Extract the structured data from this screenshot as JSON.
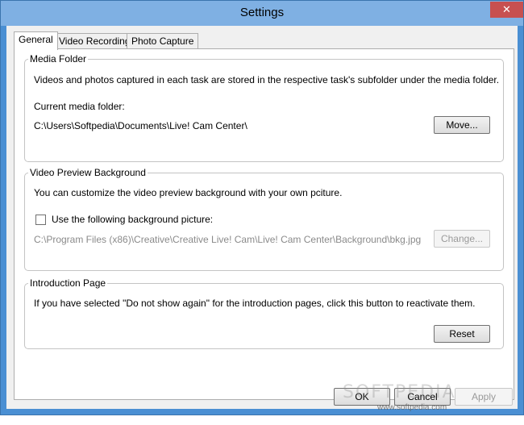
{
  "window": {
    "title": "Settings",
    "close_glyph": "✕"
  },
  "tabs": [
    {
      "label": "General",
      "active": true
    },
    {
      "label": "Video Recording",
      "active": false
    },
    {
      "label": "Photo Capture",
      "active": false
    }
  ],
  "media_folder": {
    "group_label": "Media Folder",
    "description": "Videos and photos captured in each task are stored in the respective task's subfolder under the media folder.",
    "current_label": "Current media folder:",
    "current_path": "C:\\Users\\Softpedia\\Documents\\Live! Cam Center\\",
    "move_button": "Move..."
  },
  "preview_background": {
    "group_label": "Video Preview Background",
    "description": "You can customize the video preview background with your own pciture.",
    "checkbox_label": "Use the following background picture:",
    "checked": false,
    "picture_path": "C:\\Program Files (x86)\\Creative\\Creative Live! Cam\\Live! Cam Center\\Background\\bkg.jpg",
    "change_button": "Change..."
  },
  "intro_page": {
    "group_label": "Introduction Page",
    "description": "If you have selected \"Do not show again\" for the introduction pages, click this button to reactivate them.",
    "reset_button": "Reset"
  },
  "footer": {
    "ok_button": "OK",
    "cancel_button": "Cancel",
    "apply_button": "Apply"
  },
  "watermark": {
    "logo_text": "SOFTPEDIA",
    "url_text": "www.softpedia.com"
  }
}
